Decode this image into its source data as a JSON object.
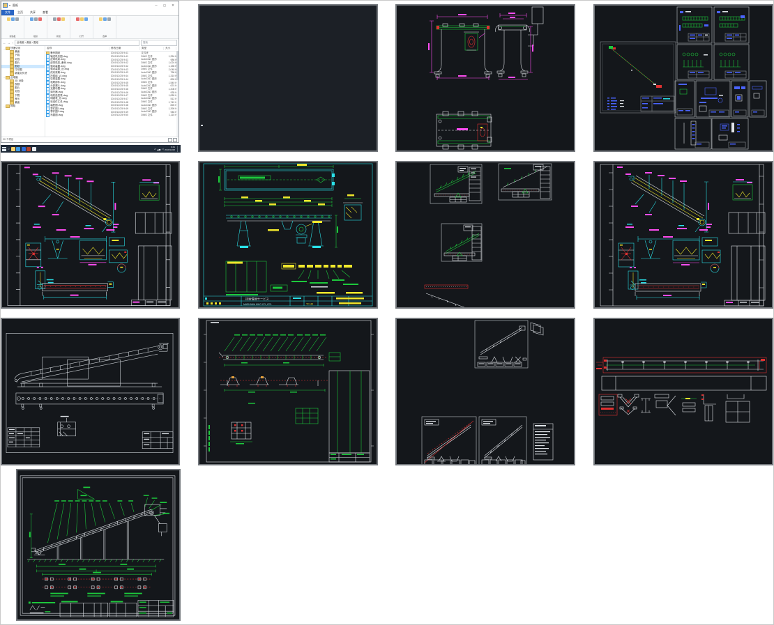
{
  "explorer": {
    "window_title": "图纸",
    "qat_glyph": "▾",
    "tabs": [
      "文件",
      "主页",
      "共享",
      "查看"
    ],
    "ribbon_groups": [
      "剪贴板",
      "组织",
      "新建",
      "打开",
      "选择"
    ],
    "nav_back": "←",
    "nav_fwd": "→",
    "nav_up": "↑",
    "address": "此电脑 › 桌面 › 图纸",
    "search_placeholder": "搜索",
    "columns": [
      "名称",
      "修改日期",
      "类型",
      "大小"
    ],
    "nav": [
      {
        "label": "快速访问",
        "indent": 0,
        "arrow": "⌄"
      },
      {
        "label": "桌面",
        "indent": 1
      },
      {
        "label": "下载",
        "indent": 1
      },
      {
        "label": "文档",
        "indent": 1
      },
      {
        "label": "图片",
        "indent": 1
      },
      {
        "label": "图纸",
        "indent": 1,
        "selected": true
      },
      {
        "label": "打印图",
        "indent": 1
      },
      {
        "label": "新建文件夹",
        "indent": 1
      },
      {
        "label": "此电脑",
        "indent": 0,
        "arrow": "›"
      },
      {
        "label": "3D 对象",
        "indent": 1
      },
      {
        "label": "视频",
        "indent": 1
      },
      {
        "label": "图片",
        "indent": 1
      },
      {
        "label": "文档",
        "indent": 1
      },
      {
        "label": "下载",
        "indent": 1
      },
      {
        "label": "音乐",
        "indent": 1
      },
      {
        "label": "桌面",
        "indent": 1
      },
      {
        "label": "网络",
        "indent": 0,
        "arrow": "›"
      }
    ],
    "files": [
      {
        "name": "备份图纸",
        "date": "2019/12/25 9:41",
        "type": "文件夹",
        "size": "",
        "folder": true
      },
      {
        "name": "输送机总图.dwg",
        "date": "2019/12/25 9:41",
        "type": "DWG 文件",
        "size": "1,254 KB"
      },
      {
        "name": "皮带机架.dwg",
        "date": "2019/12/25 9:41",
        "type": "AutoCAD 图形",
        "size": "986 KB"
      },
      {
        "name": "皮带机架_备份.dwg",
        "date": "2019/12/25 9:42",
        "type": "DWG 文件",
        "size": "1,024 KB"
      },
      {
        "name": "驱动装置.dwg",
        "date": "2019/12/25 9:42",
        "type": "AutoCAD 图形",
        "size": "1,156 KB"
      },
      {
        "name": "驱动装置_旧.dwg",
        "date": "2019/12/25 9:43",
        "type": "DWG 文件",
        "size": "2,048 KB"
      },
      {
        "name": "改向滚筒.dwg",
        "date": "2019/12/25 9:43",
        "type": "AutoCAD 图形",
        "size": "756 KB"
      },
      {
        "name": "托辊组_v2.dwg",
        "date": "2019/12/25 9:44",
        "type": "DWG 文件",
        "size": "1,310 KB"
      },
      {
        "name": "张紧装置.dwg",
        "date": "2019/12/25 9:44",
        "type": "AutoCAD 图形",
        "size": "890 KB"
      },
      {
        "name": "机尾部件.dwg",
        "date": "2019/12/25 9:45",
        "type": "DWG 文件",
        "size": "1,540 KB"
      },
      {
        "name": "头部漏斗.dwg",
        "date": "2019/12/25 9:45",
        "type": "AutoCAD 图形",
        "size": "674 KB"
      },
      {
        "name": "支腿布置.dwg",
        "date": "2019/12/25 9:46",
        "type": "DWG 文件",
        "size": "1,208 KB"
      },
      {
        "name": "清扫器.dwg",
        "date": "2019/12/25 9:46",
        "type": "AutoCAD 图形",
        "size": "935 KB"
      },
      {
        "name": "电机选型表.dwg",
        "date": "2019/12/25 9:47",
        "type": "DWG 文件",
        "size": "1,080 KB"
      },
      {
        "name": "明细表_总.dwg",
        "date": "2019/12/25 9:47",
        "type": "AutoCAD 图形",
        "size": "512 KB"
      },
      {
        "name": "标准件汇总.dwg",
        "date": "2019/12/25 9:48",
        "type": "DWG 文件",
        "size": "1,742 KB"
      },
      {
        "name": "装配图.dwg",
        "date": "2019/12/25 9:48",
        "type": "AutoCAD 图形",
        "size": "826 KB"
      },
      {
        "name": "零件图1.dwg",
        "date": "2019/12/25 9:49",
        "type": "DWG 文件",
        "size": "1,390 KB"
      },
      {
        "name": "零件图2.dwg",
        "date": "2019/12/25 9:49",
        "type": "AutoCAD 图形",
        "size": "948 KB"
      },
      {
        "name": "布置图.dwg",
        "date": "2019/12/25 9:50",
        "type": "DWG 文件",
        "size": "1,115 KB"
      }
    ],
    "status": "20 个项目",
    "tray_expand": "∧",
    "clock_time": "9:41",
    "clock_date": "2019/12/25"
  },
  "sheets": {
    "f": {
      "service": "技術情報サービス",
      "company": "MAEKAWA KIKO CO.,LTD.",
      "model": "TC-40"
    }
  },
  "colors": {
    "cad_magenta": "#ff4df2",
    "cad_yellow": "#f0e72c",
    "cad_cyan": "#2ae0e8",
    "cad_green": "#1dc93c",
    "cad_red": "#e03131",
    "cad_blue": "#4a63ff",
    "cad_white": "#dfe3e8",
    "cad_background": "#14171b",
    "explorer_tab_accent": "#2b66c4",
    "nav_selection": "#cde8ff",
    "taskbar": "#202b39"
  }
}
